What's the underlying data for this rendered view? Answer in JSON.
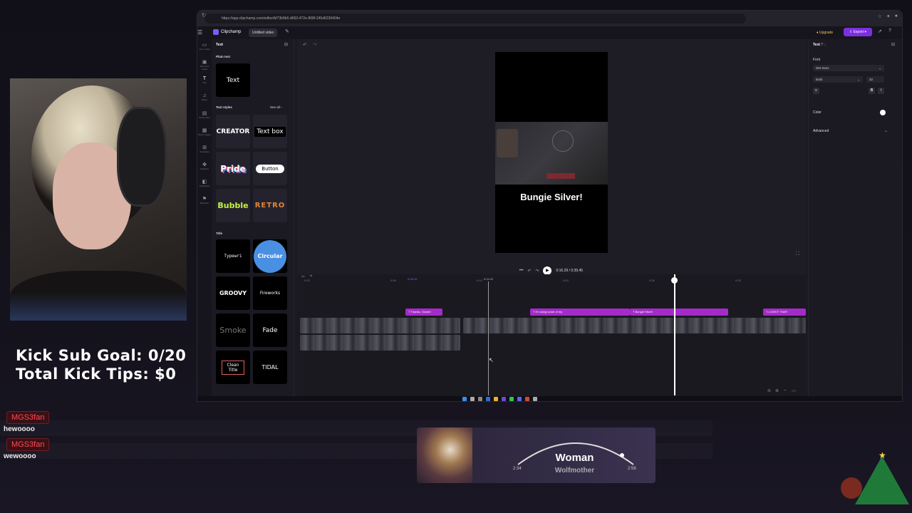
{
  "overlay": {
    "goals": [
      "Kick Sub Goal: 0/20",
      "Total Kick Tips: $0"
    ],
    "chat": [
      {
        "user": "MGS3fan",
        "text": "hewoooo"
      },
      {
        "user": "MGS3fan",
        "text": "wewoooo"
      }
    ],
    "now_playing": {
      "title": "Woman",
      "artist": "Wolfmother",
      "elapsed": "2:34",
      "total": "2:56",
      "progress": 0.875
    }
  },
  "browser": {
    "url": "https://app.clipchamp.com/editor/bf73b9b6-d063-472e-868f-245d6236404e"
  },
  "app": {
    "name": "Clipchamp",
    "project_name": "Untitled video",
    "upgrade_label": "Upgrade",
    "export_label": "Export",
    "rail": [
      {
        "icon": "folder-icon",
        "label": "Your media"
      },
      {
        "icon": "record-icon",
        "label": "Record & create"
      },
      {
        "icon": "text-icon",
        "label": "Text"
      },
      {
        "icon": "music-icon",
        "label": "Music"
      },
      {
        "icon": "stock-video-icon",
        "label": "Stock video"
      },
      {
        "icon": "stock-images-icon",
        "label": "Stock images"
      },
      {
        "icon": "templates-icon",
        "label": "Templates"
      },
      {
        "icon": "graphics-icon",
        "label": "Graphics"
      },
      {
        "icon": "transitions-icon",
        "label": "Transitions"
      },
      {
        "icon": "brand-kit-icon",
        "label": "Brand kit"
      }
    ],
    "text_panel": {
      "title": "Text",
      "plain_text_section": "Plain text",
      "plain_text_tile": "Text",
      "styles_section": "Text styles",
      "see_all": "See all",
      "styles": [
        "CREATOR",
        "Text box",
        "Pride",
        "Button",
        "Bubble",
        "RETRO"
      ],
      "title_section": "Title",
      "titles": [
        "Typewri",
        "Circular",
        "GROOVY",
        "Fireworks",
        "Smoke",
        "Fade",
        "Clean Title",
        "TIDAL"
      ]
    },
    "preview": {
      "caption": "Bungie Silver!",
      "current_time": "0:16.29",
      "duration": "0:39.45"
    },
    "properties": {
      "tab": "Text",
      "font_label": "Font",
      "font_value": "DM Sans",
      "weight_value": "Bold",
      "size_value": "32",
      "color_label": "Color",
      "advanced_label": "Advanced"
    },
    "timeline": {
      "ticks": [
        "0:02",
        "0:08",
        "0:14",
        "0:20",
        "0:26",
        "0:32"
      ],
      "hover_time": "0:08.45",
      "marker_time": "0:14.22",
      "text_clips": [
        "Thanks, Oceah!",
        "I'm using some of my",
        "Bungie Silver!",
        "LOOKIT THAT!"
      ]
    }
  }
}
